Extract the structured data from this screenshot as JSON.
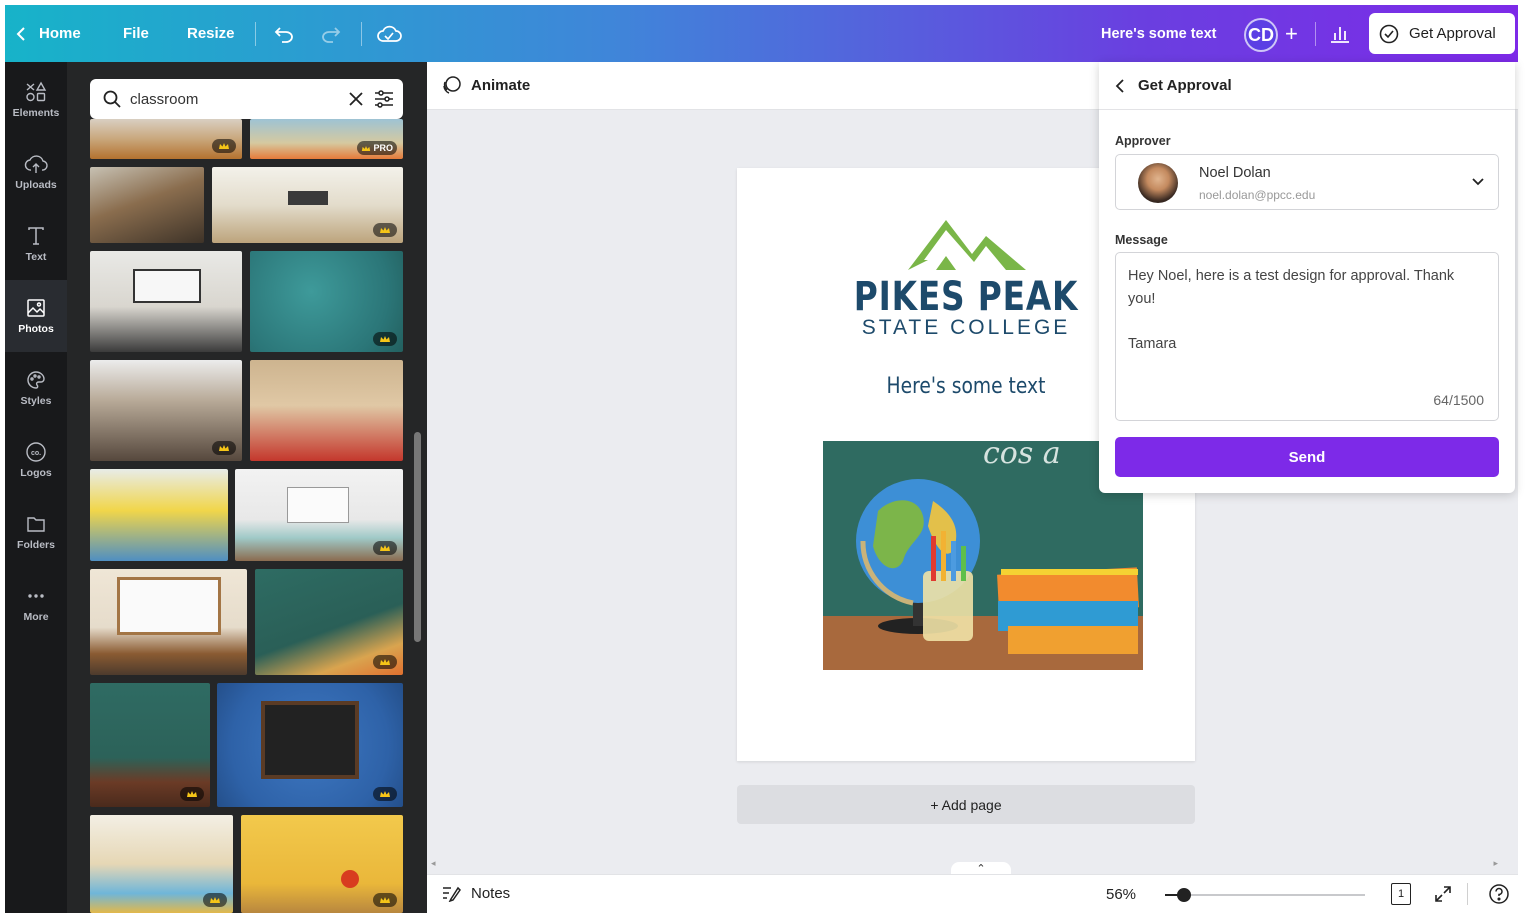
{
  "topbar": {
    "home_label": "Home",
    "file_label": "File",
    "resize_label": "Resize",
    "design_title": "Here's some text",
    "avatar_initials": "CD",
    "get_approval_label": "Get Approval"
  },
  "rail": {
    "items": [
      {
        "label": "Elements",
        "icon": "shapes-icon"
      },
      {
        "label": "Uploads",
        "icon": "cloud-upload-icon"
      },
      {
        "label": "Text",
        "icon": "text-icon"
      },
      {
        "label": "Photos",
        "icon": "image-icon"
      },
      {
        "label": "Styles",
        "icon": "palette-icon"
      },
      {
        "label": "Logos",
        "icon": "logo-icon"
      },
      {
        "label": "Folders",
        "icon": "folder-icon"
      },
      {
        "label": "More",
        "icon": "more-icon"
      }
    ],
    "active": "Photos"
  },
  "search": {
    "value": "classroom"
  },
  "photos": {
    "pro_badge": "PRO"
  },
  "toolbar": {
    "animate_label": "Animate"
  },
  "page": {
    "logo_line1": "PIKES PEAK",
    "logo_line2": "STATE COLLEGE",
    "text": "Here's some text",
    "image_chalk": "cos a"
  },
  "add_page_label": "+ Add page",
  "footer": {
    "notes_label": "Notes",
    "zoom": "56%",
    "zoom_level": 0.09,
    "page_count": "1"
  },
  "popup": {
    "title": "Get Approval",
    "approver_label": "Approver",
    "approver_name": "Noel Dolan",
    "approver_email": "noel.dolan@ppcc.edu",
    "message_label": "Message",
    "message_line1": "Hey Noel, here is a test design for approval. Thank",
    "message_line2": "you!",
    "message_line3": "Tamara",
    "char_count": "64/1500",
    "send_label": "Send"
  },
  "colors": {
    "brand_purple": "#7d2ae8",
    "teal": "#17b3c9",
    "logo_green": "#7ab648",
    "logo_navy": "#1d4a6b"
  }
}
